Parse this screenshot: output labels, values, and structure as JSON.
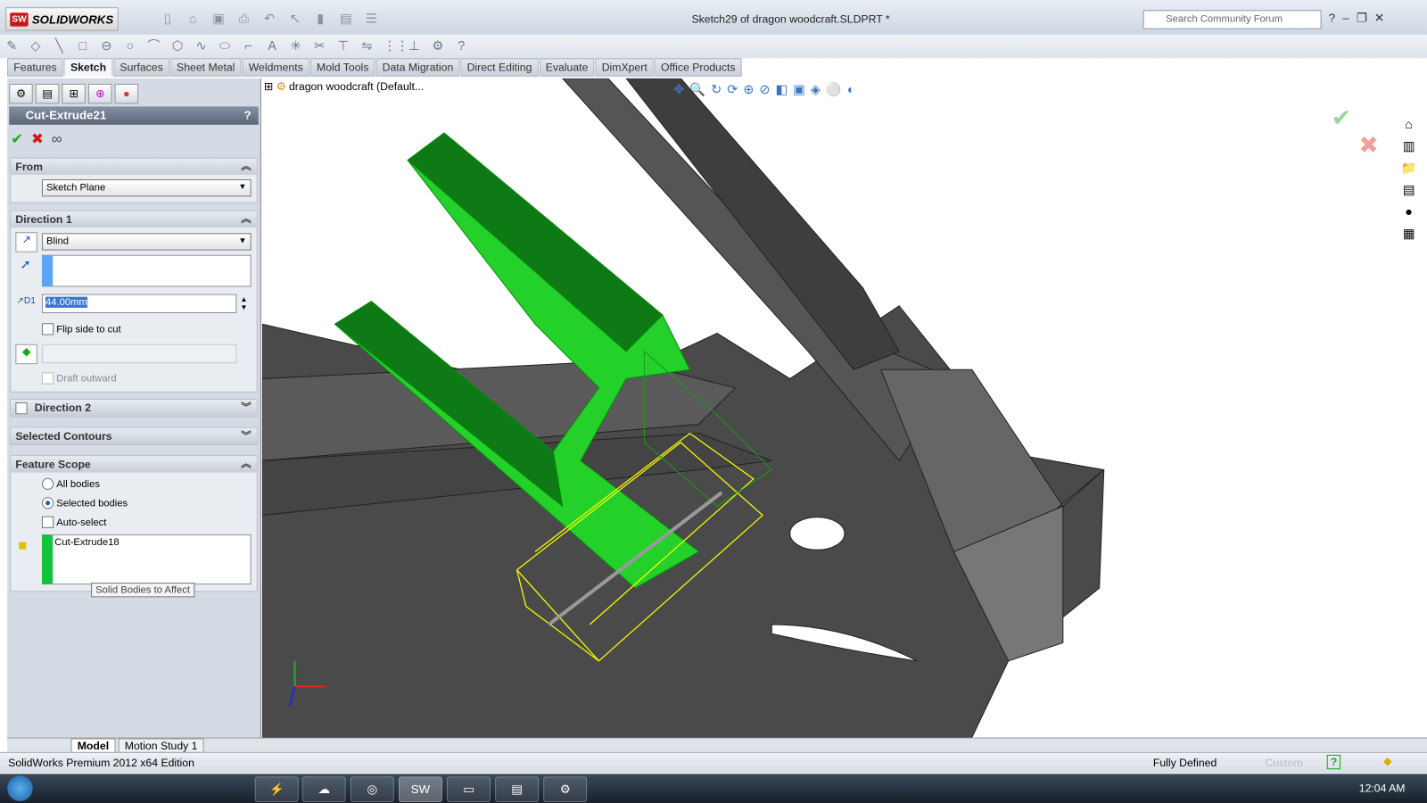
{
  "app": {
    "logo": "SOLIDWORKS",
    "title": "Sketch29 of dragon woodcraft.SLDPRT *"
  },
  "search": {
    "placeholder": "Search Community Forum"
  },
  "tabs": [
    "Features",
    "Sketch",
    "Surfaces",
    "Sheet Metal",
    "Weldments",
    "Mold Tools",
    "Data Migration",
    "Direct Editing",
    "Evaluate",
    "DimXpert",
    "Office Products"
  ],
  "active_tab": "Sketch",
  "tree": {
    "root": "dragon woodcraft  (Default..."
  },
  "property_manager": {
    "title": "Cut-Extrude21",
    "help": "?",
    "from": {
      "label": "From",
      "value": "Sketch Plane"
    },
    "direction1": {
      "label": "Direction 1",
      "end_condition": "Blind",
      "depth": "44.00mm",
      "flip_label": "Flip side to cut",
      "flip_checked": false,
      "draft_label": "Draft outward",
      "draft_checked": false
    },
    "direction2": {
      "label": "Direction 2",
      "checked": false
    },
    "selected_contours": {
      "label": "Selected Contours"
    },
    "feature_scope": {
      "label": "Feature Scope",
      "all_bodies": "All bodies",
      "selected_bodies": "Selected bodies",
      "selected": "Selected bodies",
      "auto_select": "Auto-select",
      "auto_select_checked": false,
      "bodies": [
        "Cut-Extrude18"
      ]
    },
    "tooltip": "Solid Bodies to Affect"
  },
  "bottom_tabs": [
    "Model",
    "Motion Study 1"
  ],
  "status": {
    "edition": "SolidWorks Premium 2012 x64 Edition",
    "state": "Fully Defined",
    "units": "Custom"
  },
  "taskbar": {
    "clock": "12:04 AM"
  },
  "colors": {
    "accent_green": "#22dd22",
    "body_gray": "#4a4a4a",
    "preview_yellow": "#ffff00",
    "title_bar": "#5c6679"
  }
}
